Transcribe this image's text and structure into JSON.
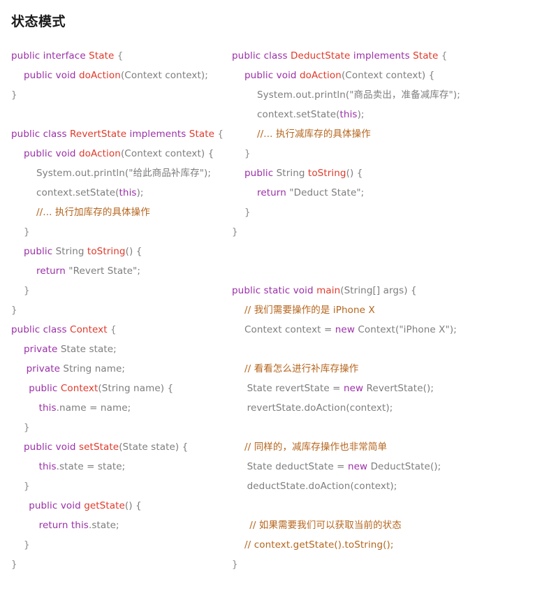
{
  "page": {
    "title": "状态模式",
    "background": "#ffffff"
  },
  "colors": {
    "keyword": "#9b2fa8",
    "type": "#e0392a",
    "plain": "#7d7d7d",
    "comment": "#b5651d",
    "brace": "#8a8a8a",
    "title": "#1a1a1a"
  },
  "columns": {
    "left": {
      "lines": [
        {
          "indent": 0,
          "tokens": [
            {
              "t": "public",
              "c": "k"
            },
            {
              "t": " ",
              "c": "p"
            },
            {
              "t": "interface",
              "c": "k"
            },
            {
              "t": " ",
              "c": "p"
            },
            {
              "t": "State",
              "c": "t"
            },
            {
              "t": " {",
              "c": "b"
            }
          ]
        },
        {
          "indent": 1,
          "tokens": [
            {
              "t": "public",
              "c": "k"
            },
            {
              "t": " ",
              "c": "p"
            },
            {
              "t": "void",
              "c": "k"
            },
            {
              "t": " ",
              "c": "p"
            },
            {
              "t": "doAction",
              "c": "t"
            },
            {
              "t": "(Context context);",
              "c": "p"
            }
          ]
        },
        {
          "indent": 0,
          "tokens": [
            {
              "t": "}",
              "c": "b"
            }
          ]
        },
        {
          "indent": 0,
          "tokens": [
            {
              "t": "",
              "c": "p"
            }
          ]
        },
        {
          "indent": 0,
          "tokens": [
            {
              "t": "public",
              "c": "k"
            },
            {
              "t": " ",
              "c": "p"
            },
            {
              "t": "class",
              "c": "k"
            },
            {
              "t": " ",
              "c": "p"
            },
            {
              "t": "RevertState",
              "c": "t"
            },
            {
              "t": " ",
              "c": "p"
            },
            {
              "t": "implements",
              "c": "k"
            },
            {
              "t": " ",
              "c": "p"
            },
            {
              "t": "State",
              "c": "t"
            },
            {
              "t": " {",
              "c": "b"
            }
          ]
        },
        {
          "indent": 1,
          "tokens": [
            {
              "t": "public",
              "c": "k"
            },
            {
              "t": " ",
              "c": "p"
            },
            {
              "t": "void",
              "c": "k"
            },
            {
              "t": " ",
              "c": "p"
            },
            {
              "t": "doAction",
              "c": "t"
            },
            {
              "t": "(Context context) {",
              "c": "p"
            }
          ]
        },
        {
          "indent": 2,
          "tokens": [
            {
              "t": "System.out.println(\"给此商品补库存\");",
              "c": "p"
            }
          ]
        },
        {
          "indent": 2,
          "tokens": [
            {
              "t": "context.setState(",
              "c": "p"
            },
            {
              "t": "this",
              "c": "k"
            },
            {
              "t": ");",
              "c": "p"
            }
          ]
        },
        {
          "indent": 2,
          "tokens": [
            {
              "t": "//... 执行加库存的具体操作",
              "c": "c"
            }
          ]
        },
        {
          "indent": 1,
          "tokens": [
            {
              "t": "}",
              "c": "b"
            }
          ]
        },
        {
          "indent": 1,
          "tokens": [
            {
              "t": "public",
              "c": "k"
            },
            {
              "t": " ",
              "c": "p"
            },
            {
              "t": "String",
              "c": "p"
            },
            {
              "t": " ",
              "c": "p"
            },
            {
              "t": "toString",
              "c": "t"
            },
            {
              "t": "() {",
              "c": "p"
            }
          ]
        },
        {
          "indent": 2,
          "tokens": [
            {
              "t": "return",
              "c": "k"
            },
            {
              "t": " \"Revert State\";",
              "c": "p"
            }
          ]
        },
        {
          "indent": 1,
          "tokens": [
            {
              "t": "}",
              "c": "b"
            }
          ]
        },
        {
          "indent": 0,
          "tokens": [
            {
              "t": "}",
              "c": "b"
            }
          ]
        },
        {
          "indent": 0,
          "tokens": [
            {
              "t": "public",
              "c": "k"
            },
            {
              "t": " ",
              "c": "p"
            },
            {
              "t": "class",
              "c": "k"
            },
            {
              "t": " ",
              "c": "p"
            },
            {
              "t": "Context",
              "c": "t"
            },
            {
              "t": " {",
              "c": "b"
            }
          ]
        },
        {
          "indent": 1,
          "tokens": [
            {
              "t": "private",
              "c": "k"
            },
            {
              "t": " State state;",
              "c": "p"
            }
          ]
        },
        {
          "indent": 1.2,
          "tokens": [
            {
              "t": "private",
              "c": "k"
            },
            {
              "t": " String name;",
              "c": "p"
            }
          ]
        },
        {
          "indent": 1.4,
          "tokens": [
            {
              "t": "public",
              "c": "k"
            },
            {
              "t": " ",
              "c": "p"
            },
            {
              "t": "Context",
              "c": "t"
            },
            {
              "t": "(String name) {",
              "c": "p"
            }
          ]
        },
        {
          "indent": 2.2,
          "tokens": [
            {
              "t": "this",
              "c": "k"
            },
            {
              "t": ".name = name;",
              "c": "p"
            }
          ]
        },
        {
          "indent": 1,
          "tokens": [
            {
              "t": "}",
              "c": "b"
            }
          ]
        },
        {
          "indent": 1,
          "tokens": [
            {
              "t": "public",
              "c": "k"
            },
            {
              "t": " ",
              "c": "p"
            },
            {
              "t": "void",
              "c": "k"
            },
            {
              "t": " ",
              "c": "p"
            },
            {
              "t": "setState",
              "c": "t"
            },
            {
              "t": "(State state) {",
              "c": "p"
            }
          ]
        },
        {
          "indent": 2.2,
          "tokens": [
            {
              "t": "this",
              "c": "k"
            },
            {
              "t": ".state = state;",
              "c": "p"
            }
          ]
        },
        {
          "indent": 1,
          "tokens": [
            {
              "t": "}",
              "c": "b"
            }
          ]
        },
        {
          "indent": 1.4,
          "tokens": [
            {
              "t": "public",
              "c": "k"
            },
            {
              "t": " ",
              "c": "p"
            },
            {
              "t": "void",
              "c": "k"
            },
            {
              "t": " ",
              "c": "p"
            },
            {
              "t": "getState",
              "c": "t"
            },
            {
              "t": "() {",
              "c": "p"
            }
          ]
        },
        {
          "indent": 2.2,
          "tokens": [
            {
              "t": "return",
              "c": "k"
            },
            {
              "t": " ",
              "c": "p"
            },
            {
              "t": "this",
              "c": "k"
            },
            {
              "t": ".state;",
              "c": "p"
            }
          ]
        },
        {
          "indent": 1,
          "tokens": [
            {
              "t": "}",
              "c": "b"
            }
          ]
        },
        {
          "indent": 0,
          "tokens": [
            {
              "t": "}",
              "c": "b"
            }
          ]
        }
      ]
    },
    "right": {
      "lines": [
        {
          "indent": 0,
          "tokens": [
            {
              "t": "public",
              "c": "k"
            },
            {
              "t": " ",
              "c": "p"
            },
            {
              "t": "class",
              "c": "k"
            },
            {
              "t": " ",
              "c": "p"
            },
            {
              "t": "DeductState",
              "c": "t"
            },
            {
              "t": " ",
              "c": "p"
            },
            {
              "t": "implements",
              "c": "k"
            },
            {
              "t": " ",
              "c": "p"
            },
            {
              "t": "State",
              "c": "t"
            },
            {
              "t": " {",
              "c": "b"
            }
          ]
        },
        {
          "indent": 1,
          "tokens": [
            {
              "t": "public",
              "c": "k"
            },
            {
              "t": " ",
              "c": "p"
            },
            {
              "t": "void",
              "c": "k"
            },
            {
              "t": " ",
              "c": "p"
            },
            {
              "t": "doAction",
              "c": "t"
            },
            {
              "t": "(Context context) {",
              "c": "p"
            }
          ]
        },
        {
          "indent": 2,
          "tokens": [
            {
              "t": "System.out.println(\"商品卖出，准备减库存\");",
              "c": "p"
            }
          ]
        },
        {
          "indent": 2,
          "tokens": [
            {
              "t": "context.setState(",
              "c": "p"
            },
            {
              "t": "this",
              "c": "k"
            },
            {
              "t": ");",
              "c": "p"
            }
          ]
        },
        {
          "indent": 2,
          "tokens": [
            {
              "t": "//... 执行减库存的具体操作",
              "c": "c"
            }
          ]
        },
        {
          "indent": 1,
          "tokens": [
            {
              "t": "}",
              "c": "b"
            }
          ]
        },
        {
          "indent": 1,
          "tokens": [
            {
              "t": "public",
              "c": "k"
            },
            {
              "t": " ",
              "c": "p"
            },
            {
              "t": "String",
              "c": "p"
            },
            {
              "t": " ",
              "c": "p"
            },
            {
              "t": "toString",
              "c": "t"
            },
            {
              "t": "() {",
              "c": "p"
            }
          ]
        },
        {
          "indent": 2,
          "tokens": [
            {
              "t": "return",
              "c": "k"
            },
            {
              "t": " \"Deduct State\";",
              "c": "p"
            }
          ]
        },
        {
          "indent": 1,
          "tokens": [
            {
              "t": "}",
              "c": "b"
            }
          ]
        },
        {
          "indent": 0,
          "tokens": [
            {
              "t": "}",
              "c": "b"
            }
          ]
        },
        {
          "indent": 0,
          "tokens": [
            {
              "t": "",
              "c": "p"
            }
          ]
        },
        {
          "indent": 0,
          "tokens": [
            {
              "t": "",
              "c": "p"
            }
          ]
        },
        {
          "indent": 0,
          "tokens": [
            {
              "t": "public",
              "c": "k"
            },
            {
              "t": " ",
              "c": "p"
            },
            {
              "t": "static",
              "c": "k"
            },
            {
              "t": " ",
              "c": "p"
            },
            {
              "t": "void",
              "c": "k"
            },
            {
              "t": " ",
              "c": "p"
            },
            {
              "t": "main",
              "c": "t"
            },
            {
              "t": "(String[] args) {",
              "c": "p"
            }
          ]
        },
        {
          "indent": 1,
          "tokens": [
            {
              "t": "// 我们需要操作的是 iPhone X",
              "c": "c"
            }
          ]
        },
        {
          "indent": 1,
          "tokens": [
            {
              "t": "Context context = ",
              "c": "p"
            },
            {
              "t": "new",
              "c": "k"
            },
            {
              "t": " Context(\"iPhone X\");",
              "c": "p"
            }
          ]
        },
        {
          "indent": 0,
          "tokens": [
            {
              "t": "",
              "c": "p"
            }
          ]
        },
        {
          "indent": 1,
          "tokens": [
            {
              "t": "// 看看怎么进行补库存操作",
              "c": "c"
            }
          ]
        },
        {
          "indent": 1.2,
          "tokens": [
            {
              "t": "State revertState = ",
              "c": "p"
            },
            {
              "t": "new",
              "c": "k"
            },
            {
              "t": " RevertState();",
              "c": "p"
            }
          ]
        },
        {
          "indent": 1.2,
          "tokens": [
            {
              "t": "revertState.doAction(context);",
              "c": "p"
            }
          ]
        },
        {
          "indent": 0,
          "tokens": [
            {
              "t": "",
              "c": "p"
            }
          ]
        },
        {
          "indent": 1,
          "tokens": [
            {
              "t": "// 同样的，减库存操作也非常简单",
              "c": "c"
            }
          ]
        },
        {
          "indent": 1.2,
          "tokens": [
            {
              "t": "State deductState = ",
              "c": "p"
            },
            {
              "t": "new",
              "c": "k"
            },
            {
              "t": " DeductState();",
              "c": "p"
            }
          ]
        },
        {
          "indent": 1.2,
          "tokens": [
            {
              "t": "deductState.doAction(context);",
              "c": "p"
            }
          ]
        },
        {
          "indent": 0,
          "tokens": [
            {
              "t": "",
              "c": "p"
            }
          ]
        },
        {
          "indent": 1.4,
          "tokens": [
            {
              "t": "// 如果需要我们可以获取当前的状态",
              "c": "c"
            }
          ]
        },
        {
          "indent": 1,
          "tokens": [
            {
              "t": "// context.getState().toString();",
              "c": "c"
            }
          ]
        },
        {
          "indent": 0,
          "tokens": [
            {
              "t": "}",
              "c": "b"
            }
          ]
        }
      ]
    }
  }
}
